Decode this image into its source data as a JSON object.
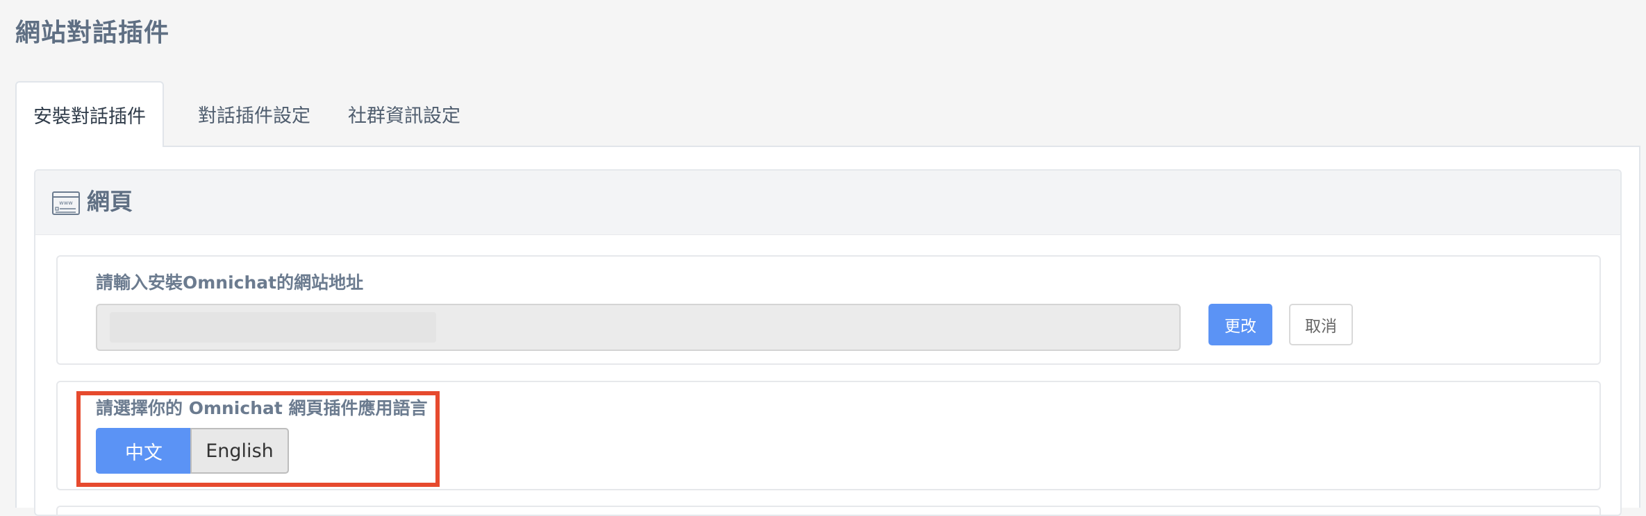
{
  "page": {
    "title": "網站對話插件"
  },
  "tabs": [
    {
      "label": "安裝對話插件",
      "active": true
    },
    {
      "label": "對話插件設定",
      "active": false
    },
    {
      "label": "社群資訊設定",
      "active": false
    }
  ],
  "section": {
    "title": "網頁",
    "icon": "web-page-icon"
  },
  "url_setting": {
    "label": "請輸入安裝Omnichat的網站地址",
    "value": "",
    "save_button": "更改",
    "cancel_button": "取消"
  },
  "language_setting": {
    "label": "請選擇你的 Omnichat 網頁插件應用語言",
    "options": [
      {
        "label": "中文",
        "selected": true
      },
      {
        "label": "English",
        "selected": false
      }
    ]
  },
  "colors": {
    "primary": "#5b93f5",
    "highlight": "#e64a2e",
    "title_gray": "#5f6f83"
  }
}
